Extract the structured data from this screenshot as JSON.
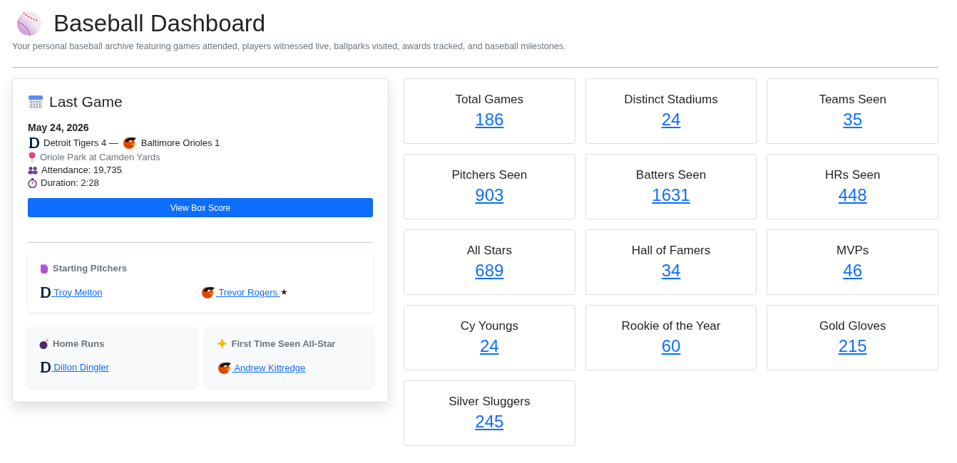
{
  "header": {
    "title": "Baseball Dashboard",
    "subtitle": "Your personal baseball archive featuring games attended, players witnessed live, ballparks visited, awards tracked, and baseball milestones."
  },
  "last_game": {
    "title": "Last Game",
    "date": "May 24, 2026",
    "home": {
      "kind": "tigers",
      "text": "Detroit Tigers 4 —"
    },
    "away": {
      "kind": "orioles",
      "text": "Baltimore Orioles 1"
    },
    "venue": "Oriole Park at Camden Yards",
    "attendance": "Attendance: 19,735",
    "duration": "Duration: 2:28",
    "button": "View Box Score",
    "starting_pitchers": {
      "title": "Starting Pitchers",
      "players": [
        {
          "kind": "tigers",
          "name": " Troy Melton"
        },
        {
          "kind": "orioles",
          "name": " Trevor Rogers ",
          "mark": "★"
        }
      ]
    },
    "home_runs": {
      "title": "Home Runs",
      "players": [
        {
          "kind": "tigers",
          "name": " Dillon Dingler"
        }
      ]
    },
    "first_all_star": {
      "title": "First Time Seen All-Star",
      "players": [
        {
          "kind": "orioles",
          "name": " Andrew Kittredge"
        }
      ]
    }
  },
  "stats": [
    {
      "label": "Total Games",
      "value": "186"
    },
    {
      "label": "Distinct Stadiums",
      "value": "24"
    },
    {
      "label": "Teams Seen",
      "value": "35"
    },
    {
      "label": "Pitchers Seen",
      "value": "903"
    },
    {
      "label": "Batters Seen",
      "value": "1631"
    },
    {
      "label": "HRs Seen",
      "value": "448"
    },
    {
      "label": "All Stars",
      "value": "689"
    },
    {
      "label": "Hall of Famers",
      "value": "34"
    },
    {
      "label": "MVPs",
      "value": "46"
    },
    {
      "label": "Cy Youngs",
      "value": "24"
    },
    {
      "label": "Rookie of the Year",
      "value": "60"
    },
    {
      "label": "Gold Gloves",
      "value": "215"
    },
    {
      "label": "Silver Sluggers",
      "value": "245"
    }
  ]
}
